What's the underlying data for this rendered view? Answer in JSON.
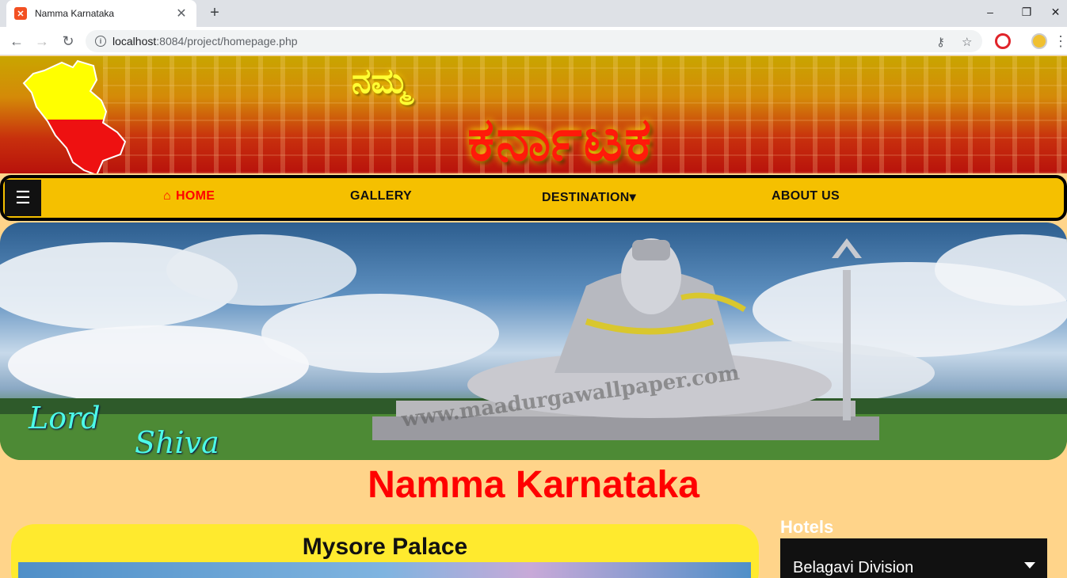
{
  "browser": {
    "tab_title": "Namma Karnataka",
    "tab_close": "✕",
    "new_tab": "+",
    "url_host": "localhost",
    "url_rest": ":8084/project/homepage.php",
    "window_controls": [
      "–",
      "❐",
      "✕"
    ]
  },
  "banner": {
    "kannada_small": "ನಮ್ಮ",
    "kannada_big": "ಕರ್ನಾಟಕ"
  },
  "nav": {
    "menu_icon": "☰",
    "home_icon": "⌂",
    "home": "HOME",
    "gallery": "GALLERY",
    "destination": "DESTINATION",
    "destination_caret": "▾",
    "about": "ABOUT US"
  },
  "hero": {
    "watermark": "www.maadurgawallpaper.com",
    "signature_line1": "Lord",
    "signature_line2": "Shiva"
  },
  "main": {
    "site_title": "Namma Karnataka",
    "card_title": "Mysore Palace"
  },
  "sidebar": {
    "heading": "Hotels",
    "dropdown_value": "Belagavi Division"
  },
  "colors": {
    "page_bg": "#ffd48a",
    "nav_bg": "#f5c000",
    "title_red": "#ff0000",
    "card_yellow": "#ffea2e"
  }
}
